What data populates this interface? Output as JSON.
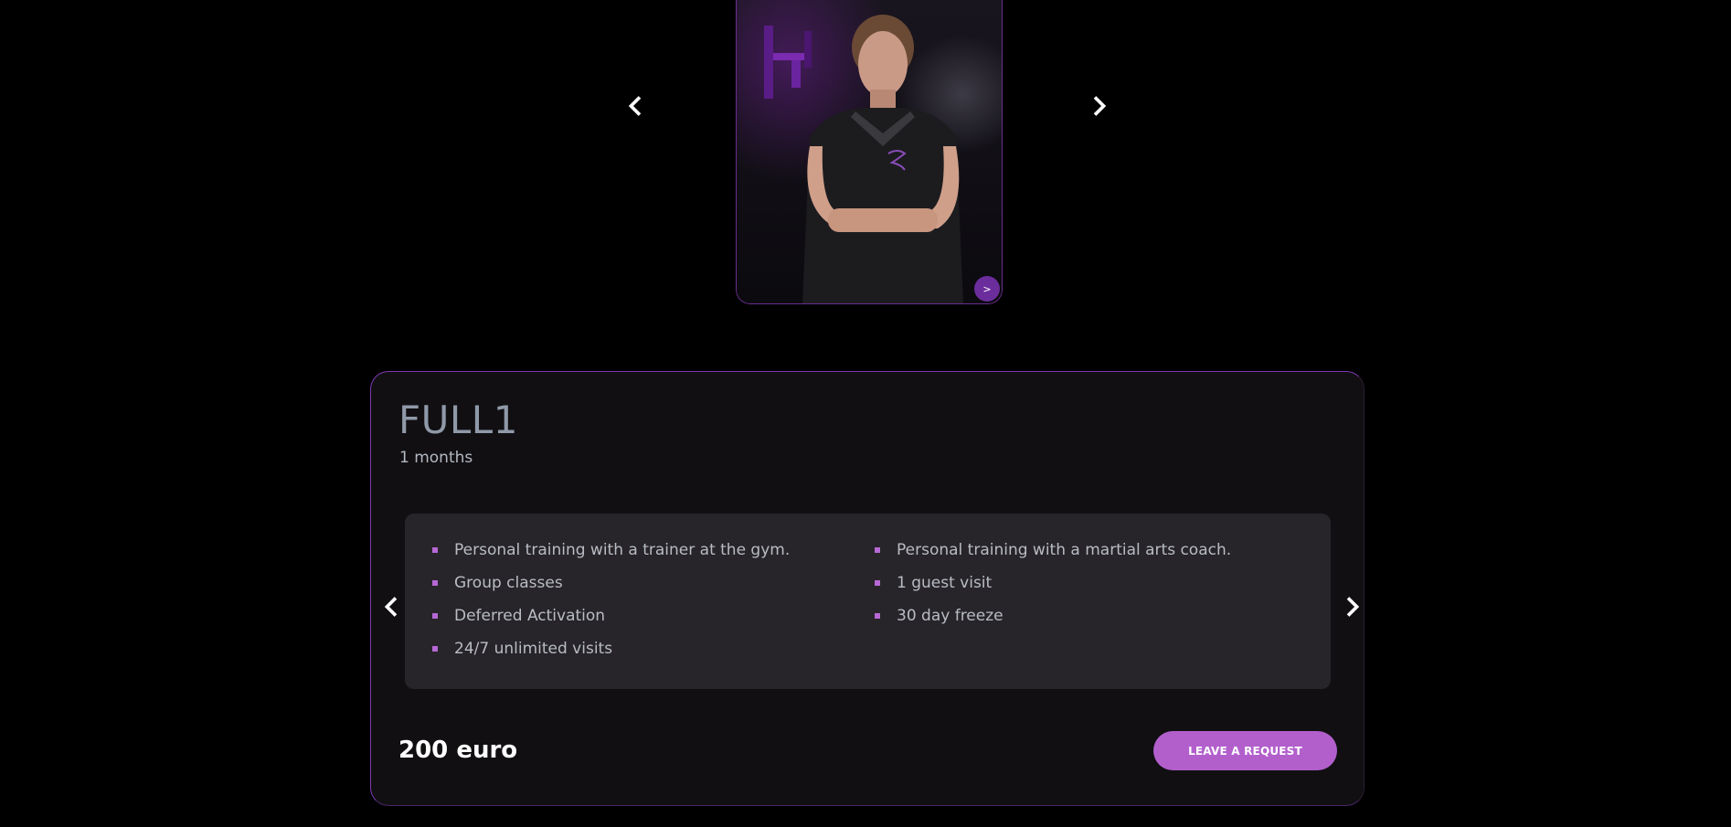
{
  "trainer_carousel": {
    "prev_icon": "chevron-left-icon",
    "next_icon": "chevron-right-icon",
    "more_button_label": ">"
  },
  "plan": {
    "title": "FULL1",
    "duration": "1 months",
    "features_left": [
      "Personal training with a trainer at the gym.",
      "Group classes",
      "Deferred Activation",
      "24/7 unlimited visits"
    ],
    "features_right": [
      "Personal training with a martial arts coach.",
      "1 guest visit",
      "30 day freeze"
    ],
    "price": "200 euro",
    "request_button_label": "LEAVE A REQUEST"
  },
  "colors": {
    "background": "#000000",
    "card_background": "#110f12",
    "accent": "#b25fcc",
    "accent_border": "#7d37b0",
    "bullet": "#b668d4"
  }
}
